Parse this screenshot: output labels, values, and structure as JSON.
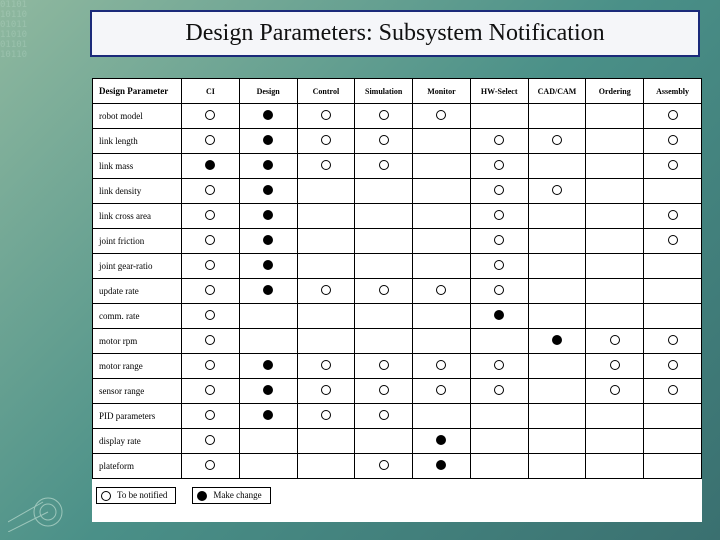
{
  "title": "Design Parameters: Subsystem Notification",
  "columns": [
    "Design Parameter",
    "CI",
    "Design",
    "Control",
    "Simulation",
    "Monitor",
    "HW-Select",
    "CAD/CAM",
    "Ordering",
    "Assembly"
  ],
  "legend": {
    "open": "To be notified",
    "filled": "Make change"
  },
  "chart_data": {
    "type": "table",
    "title": "Design Parameters: Subsystem Notification",
    "mark_meaning": {
      "open": "To be notified",
      "filled": "Make change",
      "null": "no relation"
    },
    "columns": [
      "CI",
      "Design",
      "Control",
      "Simulation",
      "Monitor",
      "HW-Select",
      "CAD/CAM",
      "Ordering",
      "Assembly"
    ],
    "rows": [
      {
        "param": "robot model",
        "cells": [
          "open",
          "filled",
          "open",
          "open",
          "open",
          null,
          null,
          null,
          "open"
        ]
      },
      {
        "param": "link length",
        "cells": [
          "open",
          "filled",
          "open",
          "open",
          null,
          "open",
          "open",
          null,
          "open"
        ]
      },
      {
        "param": "link mass",
        "cells": [
          "filled",
          "filled",
          "open",
          "open",
          null,
          "open",
          null,
          null,
          "open"
        ]
      },
      {
        "param": "link density",
        "cells": [
          "open",
          "filled",
          null,
          null,
          null,
          "open",
          "open",
          null,
          null
        ]
      },
      {
        "param": "link cross area",
        "cells": [
          "open",
          "filled",
          null,
          null,
          null,
          "open",
          null,
          null,
          "open"
        ]
      },
      {
        "param": "joint friction",
        "cells": [
          "open",
          "filled",
          null,
          null,
          null,
          "open",
          null,
          null,
          "open"
        ]
      },
      {
        "param": "joint gear-ratio",
        "cells": [
          "open",
          "filled",
          null,
          null,
          null,
          "open",
          null,
          null,
          null
        ]
      },
      {
        "param": "update rate",
        "cells": [
          "open",
          "filled",
          "open",
          "open",
          "open",
          "open",
          null,
          null,
          null
        ]
      },
      {
        "param": "comm. rate",
        "cells": [
          "open",
          null,
          null,
          null,
          null,
          "filled",
          null,
          null,
          null
        ]
      },
      {
        "param": "motor rpm",
        "cells": [
          "open",
          null,
          null,
          null,
          null,
          null,
          "filled",
          "open",
          "open"
        ]
      },
      {
        "param": "motor range",
        "cells": [
          "open",
          "filled",
          "open",
          "open",
          "open",
          "open",
          null,
          "open",
          "open"
        ]
      },
      {
        "param": "sensor range",
        "cells": [
          "open",
          "filled",
          "open",
          "open",
          "open",
          "open",
          null,
          "open",
          "open"
        ]
      },
      {
        "param": "PID parameters",
        "cells": [
          "open",
          "filled",
          "open",
          "open",
          null,
          null,
          null,
          null,
          null
        ]
      },
      {
        "param": "display rate",
        "cells": [
          "open",
          null,
          null,
          null,
          "filled",
          null,
          null,
          null,
          null
        ]
      },
      {
        "param": "plateform",
        "cells": [
          "open",
          null,
          null,
          "open",
          "filled",
          null,
          null,
          null,
          null
        ]
      }
    ]
  }
}
